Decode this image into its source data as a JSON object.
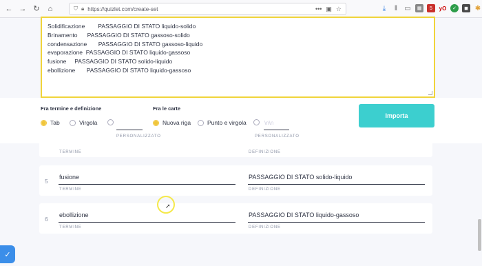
{
  "browser": {
    "url": "https://quizlet.com/create-set",
    "url_actions": "•••",
    "badge_count": "5",
    "badge_yo": "yO"
  },
  "import_text": [
    "Solidificazione        PASSAGGIO DI STATO liquido-solido",
    "Brinamento      PASSAGGIO DI STATO gassoso-solido",
    "condensazione       PASSAGGIO DI STATO gassoso-liquido",
    "evaporazione  PASSAGGIO DI STATO liquido-gassoso",
    "fusione     PASSAGGIO DI STATO solido-liquido",
    "ebollizione       PASSAGGIO DI STATO liquido-gassoso"
  ],
  "options": {
    "term_def_title": "Fra termine e definizione",
    "tab_label": "Tab",
    "comma_label": "Virgola",
    "custom_label": "PERSONALIZZATO",
    "cards_title": "Fra le carte",
    "newline_label": "Nuova riga",
    "semicolon_label": "Punto e virgola",
    "custom_placeholder": "\\n\\n",
    "import_button": "Importa"
  },
  "cards": [
    {
      "num": "",
      "term": "",
      "def": "",
      "term_label": "TERMINE",
      "def_label": "DEFINIZIONE"
    },
    {
      "num": "5",
      "term": "fusione",
      "def": "PASSAGGIO DI STATO solido-liquido",
      "term_label": "TERMINE",
      "def_label": "DEFINIZIONE"
    },
    {
      "num": "6",
      "term": "ebollizione",
      "def": "PASSAGGIO DI STATO liquido-gassoso",
      "term_label": "TERMINE",
      "def_label": "DEFINIZIONE"
    }
  ],
  "colors": {
    "accent_yellow": "#f0d43a",
    "import_button": "#3ccfcf",
    "text": "#303545"
  }
}
